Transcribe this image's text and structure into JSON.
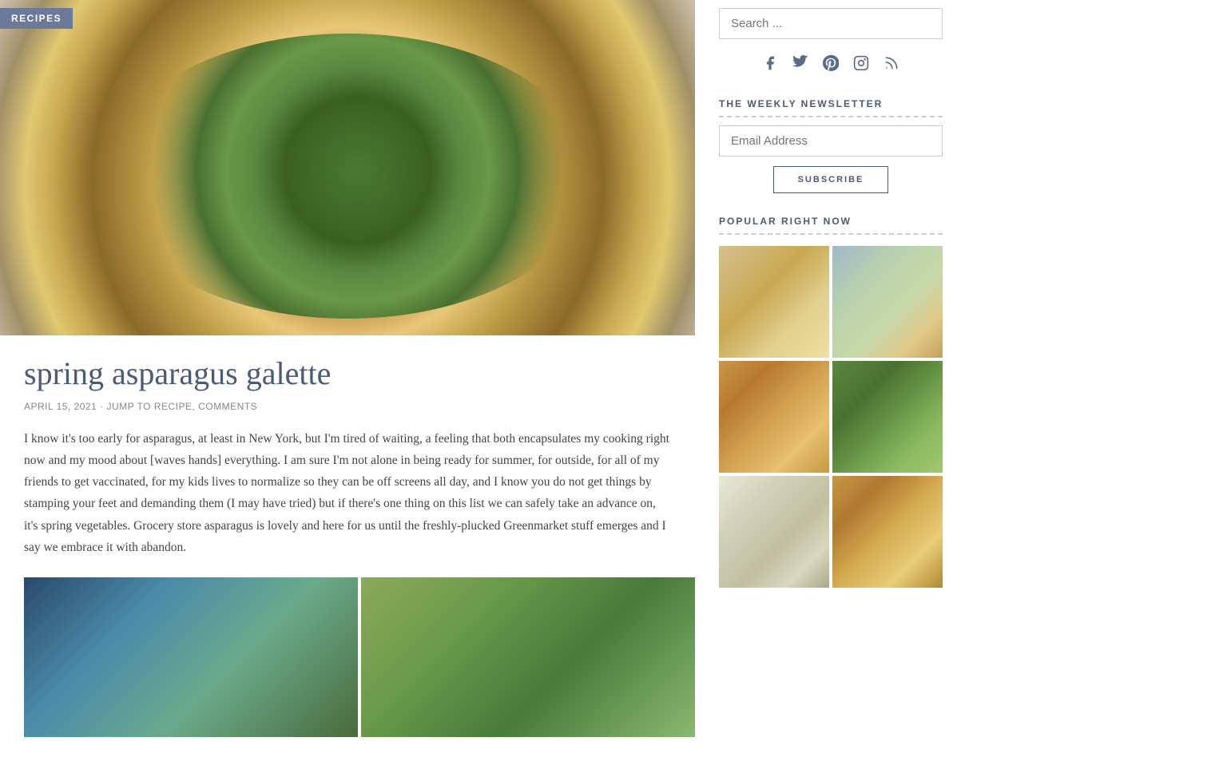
{
  "recipes_badge": "RECIPES",
  "article": {
    "title": "spring asparagus galette",
    "meta_date": "APRIL 15, 2021",
    "meta_separator": "·",
    "meta_jump": "JUMP TO RECIPE",
    "meta_comments": "COMMENTS",
    "body": "I know it's too early for asparagus, at least in New York, but I'm tired of waiting, a feeling that both encapsulates my cooking right now and my mood about [waves hands] everything. I am sure I'm not alone in being ready for summer, for outside, for all of my friends to get vaccinated, for my kids lives to normalize so they can be off screens all day, and I know you do not get things by stamping your feet and demanding them (I may have tried) but if there's one thing on this list we can safely take an advance on, it's spring vegetables. Grocery store asparagus is lovely and here for us until the freshly-plucked Greenmarket stuff emerges and I say we embrace it with abandon."
  },
  "sidebar": {
    "search_placeholder": "Search ...",
    "social_icons": [
      "facebook",
      "twitter",
      "pinterest",
      "instagram",
      "rss"
    ],
    "newsletter": {
      "title": "THE WEEKLY NEWSLETTER",
      "email_placeholder": "Email Address",
      "subscribe_label": "SUBSCRIBE"
    },
    "popular": {
      "title": "POPULAR RIGHT NOW"
    }
  }
}
